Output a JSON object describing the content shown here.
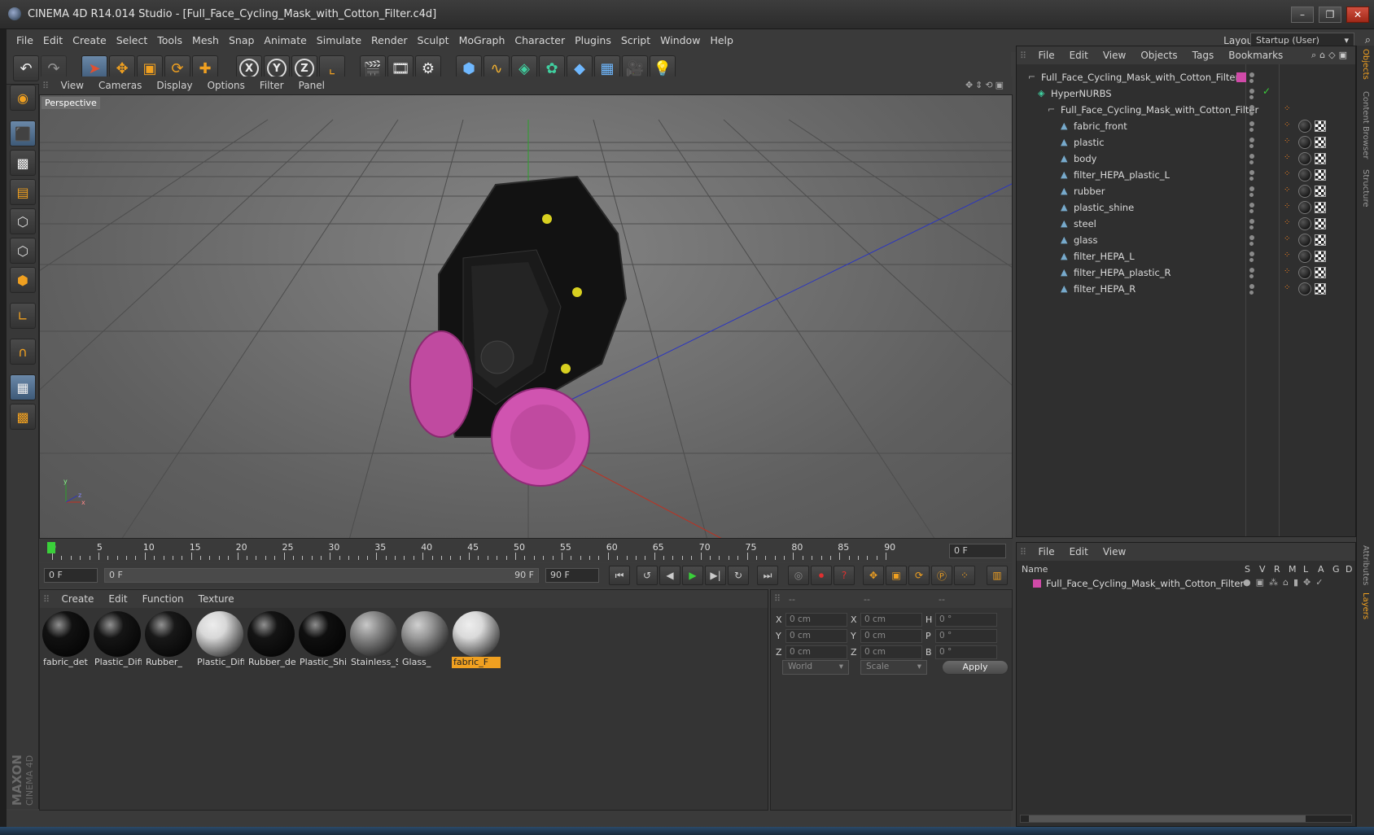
{
  "window": {
    "title": "CINEMA 4D R14.014 Studio - [Full_Face_Cycling_Mask_with_Cotton_Filter.c4d]"
  },
  "menubar": {
    "items": [
      "File",
      "Edit",
      "Create",
      "Select",
      "Tools",
      "Mesh",
      "Snap",
      "Animate",
      "Simulate",
      "Render",
      "Sculpt",
      "MoGraph",
      "Character",
      "Plugins",
      "Script",
      "Window",
      "Help"
    ],
    "layout_label": "Layout:",
    "layout_value": "Startup (User)"
  },
  "viewport": {
    "menu": [
      "View",
      "Cameras",
      "Display",
      "Options",
      "Filter",
      "Panel"
    ],
    "label": "Perspective"
  },
  "timeline": {
    "ticks": [
      "0",
      "5",
      "10",
      "15",
      "20",
      "25",
      "30",
      "35",
      "40",
      "45",
      "50",
      "55",
      "60",
      "65",
      "70",
      "75",
      "80",
      "85",
      "90"
    ],
    "current_frame": "0 F",
    "start_field": "0 F",
    "range_start": "0 F",
    "range_end": "90 F",
    "end_field": "90 F"
  },
  "materials": {
    "menu": [
      "Create",
      "Edit",
      "Function",
      "Texture"
    ],
    "items": [
      {
        "label": "fabric_det",
        "color": "#111111"
      },
      {
        "label": "Plastic_Diff",
        "color": "#151515"
      },
      {
        "label": "Rubber_",
        "color": "#181818"
      },
      {
        "label": "Plastic_Diff",
        "color": "#d8d8d8"
      },
      {
        "label": "Rubber_de",
        "color": "#141414"
      },
      {
        "label": "Plastic_Shi",
        "color": "#0f0f0f"
      },
      {
        "label": "Stainless_S",
        "color": "#8a8a8a"
      },
      {
        "label": "Glass_",
        "color": "#9a9a9a"
      },
      {
        "label": "fabric_F",
        "color": "#dadada"
      }
    ]
  },
  "attributes": {
    "headers": [
      "--",
      "--",
      "--"
    ],
    "rows": [
      {
        "a": "X",
        "av": "0 cm",
        "b": "X",
        "bv": "0 cm",
        "c": "H",
        "cv": "0 °"
      },
      {
        "a": "Y",
        "av": "0 cm",
        "b": "Y",
        "bv": "0 cm",
        "c": "P",
        "cv": "0 °"
      },
      {
        "a": "Z",
        "av": "0 cm",
        "b": "Z",
        "bv": "0 cm",
        "c": "B",
        "cv": "0 °"
      }
    ],
    "world": "World",
    "scale": "Scale",
    "apply": "Apply"
  },
  "objects": {
    "menu": [
      "File",
      "Edit",
      "View",
      "Objects",
      "Tags",
      "Bookmarks"
    ],
    "root": "Full_Face_Cycling_Mask_with_Cotton_Filter",
    "nurbs": "HyperNURBS",
    "group": "Full_Face_Cycling_Mask_with_Cotton_Filter",
    "children": [
      "fabric_front",
      "plastic",
      "body",
      "filter_HEPA_plastic_L",
      "rubber",
      "plastic_shine",
      "steel",
      "glass",
      "filter_HEPA_L",
      "filter_HEPA_plastic_R",
      "filter_HEPA_R"
    ]
  },
  "layers": {
    "menu": [
      "File",
      "Edit",
      "View"
    ],
    "columns": [
      "Name",
      "S",
      "V",
      "R",
      "M",
      "L",
      "A",
      "G",
      "D"
    ],
    "row": "Full_Face_Cycling_Mask_with_Cotton_Filter"
  },
  "right_tabs": [
    "Objects",
    "Content Browser",
    "Structure",
    "Attributes",
    "Layers"
  ],
  "branding": {
    "maxon": "MAXON",
    "product": "CINEMA 4D"
  },
  "colors": {
    "accent": "#f0a020",
    "selection": "#4a6a8a",
    "layer": "#d04aa8"
  }
}
